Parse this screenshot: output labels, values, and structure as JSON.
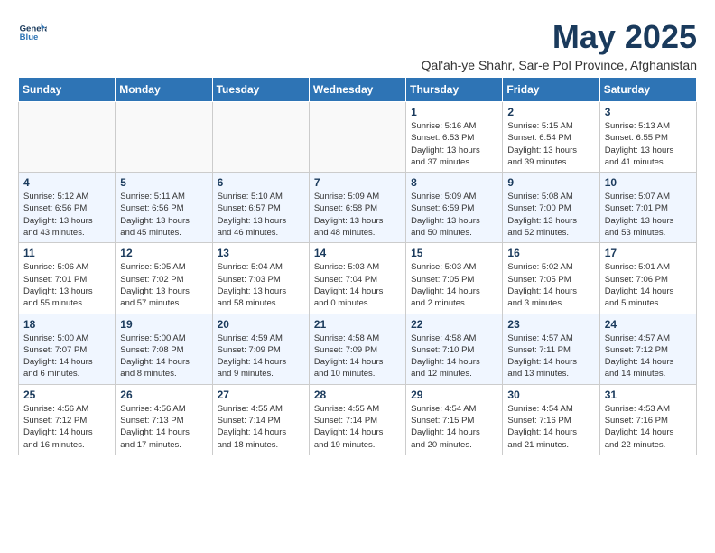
{
  "logo": {
    "line1": "General",
    "line2": "Blue"
  },
  "title": "May 2025",
  "subtitle": "Qal'ah-ye Shahr, Sar-e Pol Province, Afghanistan",
  "days_of_week": [
    "Sunday",
    "Monday",
    "Tuesday",
    "Wednesday",
    "Thursday",
    "Friday",
    "Saturday"
  ],
  "weeks": [
    [
      {
        "day": "",
        "info": ""
      },
      {
        "day": "",
        "info": ""
      },
      {
        "day": "",
        "info": ""
      },
      {
        "day": "",
        "info": ""
      },
      {
        "day": "1",
        "info": "Sunrise: 5:16 AM\nSunset: 6:53 PM\nDaylight: 13 hours\nand 37 minutes."
      },
      {
        "day": "2",
        "info": "Sunrise: 5:15 AM\nSunset: 6:54 PM\nDaylight: 13 hours\nand 39 minutes."
      },
      {
        "day": "3",
        "info": "Sunrise: 5:13 AM\nSunset: 6:55 PM\nDaylight: 13 hours\nand 41 minutes."
      }
    ],
    [
      {
        "day": "4",
        "info": "Sunrise: 5:12 AM\nSunset: 6:56 PM\nDaylight: 13 hours\nand 43 minutes."
      },
      {
        "day": "5",
        "info": "Sunrise: 5:11 AM\nSunset: 6:56 PM\nDaylight: 13 hours\nand 45 minutes."
      },
      {
        "day": "6",
        "info": "Sunrise: 5:10 AM\nSunset: 6:57 PM\nDaylight: 13 hours\nand 46 minutes."
      },
      {
        "day": "7",
        "info": "Sunrise: 5:09 AM\nSunset: 6:58 PM\nDaylight: 13 hours\nand 48 minutes."
      },
      {
        "day": "8",
        "info": "Sunrise: 5:09 AM\nSunset: 6:59 PM\nDaylight: 13 hours\nand 50 minutes."
      },
      {
        "day": "9",
        "info": "Sunrise: 5:08 AM\nSunset: 7:00 PM\nDaylight: 13 hours\nand 52 minutes."
      },
      {
        "day": "10",
        "info": "Sunrise: 5:07 AM\nSunset: 7:01 PM\nDaylight: 13 hours\nand 53 minutes."
      }
    ],
    [
      {
        "day": "11",
        "info": "Sunrise: 5:06 AM\nSunset: 7:01 PM\nDaylight: 13 hours\nand 55 minutes."
      },
      {
        "day": "12",
        "info": "Sunrise: 5:05 AM\nSunset: 7:02 PM\nDaylight: 13 hours\nand 57 minutes."
      },
      {
        "day": "13",
        "info": "Sunrise: 5:04 AM\nSunset: 7:03 PM\nDaylight: 13 hours\nand 58 minutes."
      },
      {
        "day": "14",
        "info": "Sunrise: 5:03 AM\nSunset: 7:04 PM\nDaylight: 14 hours\nand 0 minutes."
      },
      {
        "day": "15",
        "info": "Sunrise: 5:03 AM\nSunset: 7:05 PM\nDaylight: 14 hours\nand 2 minutes."
      },
      {
        "day": "16",
        "info": "Sunrise: 5:02 AM\nSunset: 7:05 PM\nDaylight: 14 hours\nand 3 minutes."
      },
      {
        "day": "17",
        "info": "Sunrise: 5:01 AM\nSunset: 7:06 PM\nDaylight: 14 hours\nand 5 minutes."
      }
    ],
    [
      {
        "day": "18",
        "info": "Sunrise: 5:00 AM\nSunset: 7:07 PM\nDaylight: 14 hours\nand 6 minutes."
      },
      {
        "day": "19",
        "info": "Sunrise: 5:00 AM\nSunset: 7:08 PM\nDaylight: 14 hours\nand 8 minutes."
      },
      {
        "day": "20",
        "info": "Sunrise: 4:59 AM\nSunset: 7:09 PM\nDaylight: 14 hours\nand 9 minutes."
      },
      {
        "day": "21",
        "info": "Sunrise: 4:58 AM\nSunset: 7:09 PM\nDaylight: 14 hours\nand 10 minutes."
      },
      {
        "day": "22",
        "info": "Sunrise: 4:58 AM\nSunset: 7:10 PM\nDaylight: 14 hours\nand 12 minutes."
      },
      {
        "day": "23",
        "info": "Sunrise: 4:57 AM\nSunset: 7:11 PM\nDaylight: 14 hours\nand 13 minutes."
      },
      {
        "day": "24",
        "info": "Sunrise: 4:57 AM\nSunset: 7:12 PM\nDaylight: 14 hours\nand 14 minutes."
      }
    ],
    [
      {
        "day": "25",
        "info": "Sunrise: 4:56 AM\nSunset: 7:12 PM\nDaylight: 14 hours\nand 16 minutes."
      },
      {
        "day": "26",
        "info": "Sunrise: 4:56 AM\nSunset: 7:13 PM\nDaylight: 14 hours\nand 17 minutes."
      },
      {
        "day": "27",
        "info": "Sunrise: 4:55 AM\nSunset: 7:14 PM\nDaylight: 14 hours\nand 18 minutes."
      },
      {
        "day": "28",
        "info": "Sunrise: 4:55 AM\nSunset: 7:14 PM\nDaylight: 14 hours\nand 19 minutes."
      },
      {
        "day": "29",
        "info": "Sunrise: 4:54 AM\nSunset: 7:15 PM\nDaylight: 14 hours\nand 20 minutes."
      },
      {
        "day": "30",
        "info": "Sunrise: 4:54 AM\nSunset: 7:16 PM\nDaylight: 14 hours\nand 21 minutes."
      },
      {
        "day": "31",
        "info": "Sunrise: 4:53 AM\nSunset: 7:16 PM\nDaylight: 14 hours\nand 22 minutes."
      }
    ]
  ]
}
